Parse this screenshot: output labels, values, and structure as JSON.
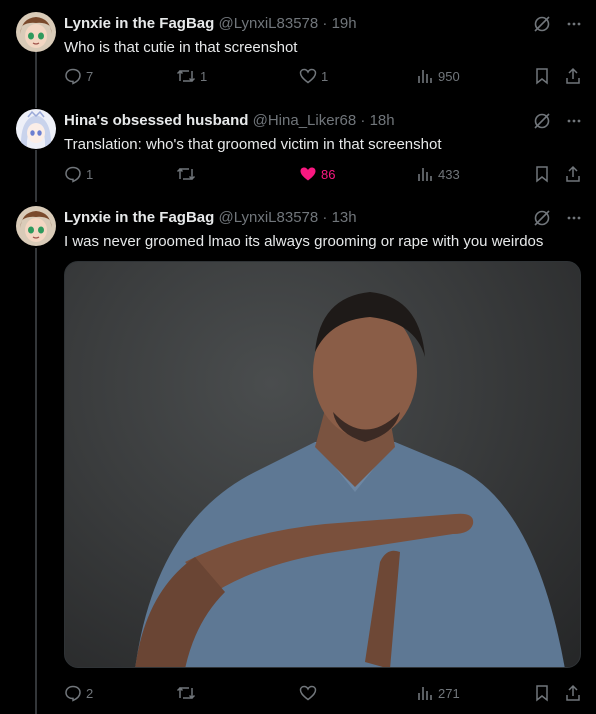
{
  "tweets": [
    {
      "name": "Lynxie in the FagBag",
      "handle": "@LynxiL83578",
      "time": "· 19h",
      "text": "Who is that cutie in that screenshot",
      "replies": "7",
      "retweets": "1",
      "likes": "1",
      "views": "950"
    },
    {
      "name": "Hina's obsessed husband",
      "handle": "@Hina_Liker68",
      "time": "· 18h",
      "text": "Translation: who's that groomed victim in that screenshot",
      "replies": "1",
      "retweets": "",
      "likes": "86",
      "views": "433"
    },
    {
      "name": "Lynxie in the FagBag",
      "handle": "@LynxiL83578",
      "time": "· 13h",
      "text": "I was never groomed lmao its always grooming or rape with you weirdos",
      "replies": "2",
      "retweets": "",
      "likes": "",
      "views": "271"
    }
  ],
  "icons": [
    "grok-icon",
    "more-icon",
    "reply-icon",
    "retweet-icon",
    "like-icon",
    "views-icon",
    "bookmark-icon",
    "share-icon"
  ],
  "colors": {
    "background": "#000000",
    "text": "#e7e9ea",
    "muted": "#71767b",
    "like": "#f91880",
    "divider": "#333639"
  }
}
